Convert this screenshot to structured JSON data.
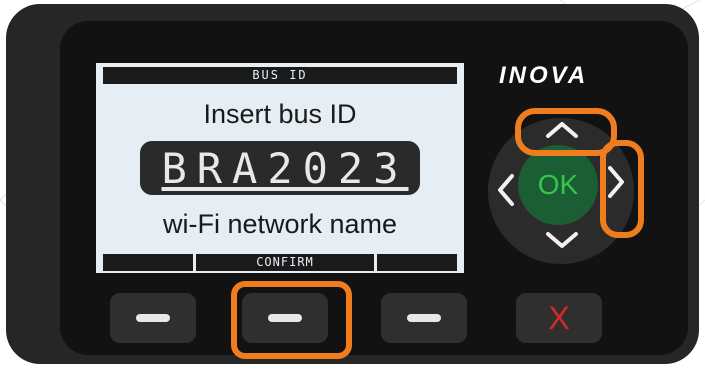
{
  "screen": {
    "title": "BUS ID",
    "prompt": "Insert bus ID",
    "bus_id_value": "BRA2023",
    "network_label": "wi-Fi network name",
    "softkeys": [
      "",
      "CONFIRM",
      ""
    ]
  },
  "brand": {
    "logo_text": "INOVA"
  },
  "dpad": {
    "ok_label": "OK"
  },
  "buttons": {
    "cancel_label": "X"
  },
  "highlights": [
    "up-arrow",
    "right-arrow",
    "middle-softkey"
  ],
  "colors": {
    "highlight": "#ef7d1e",
    "ok_bg": "#1b5e34",
    "ok_text": "#37c44f",
    "cancel": "#d62828",
    "lcd_bg": "#e6eef3"
  }
}
